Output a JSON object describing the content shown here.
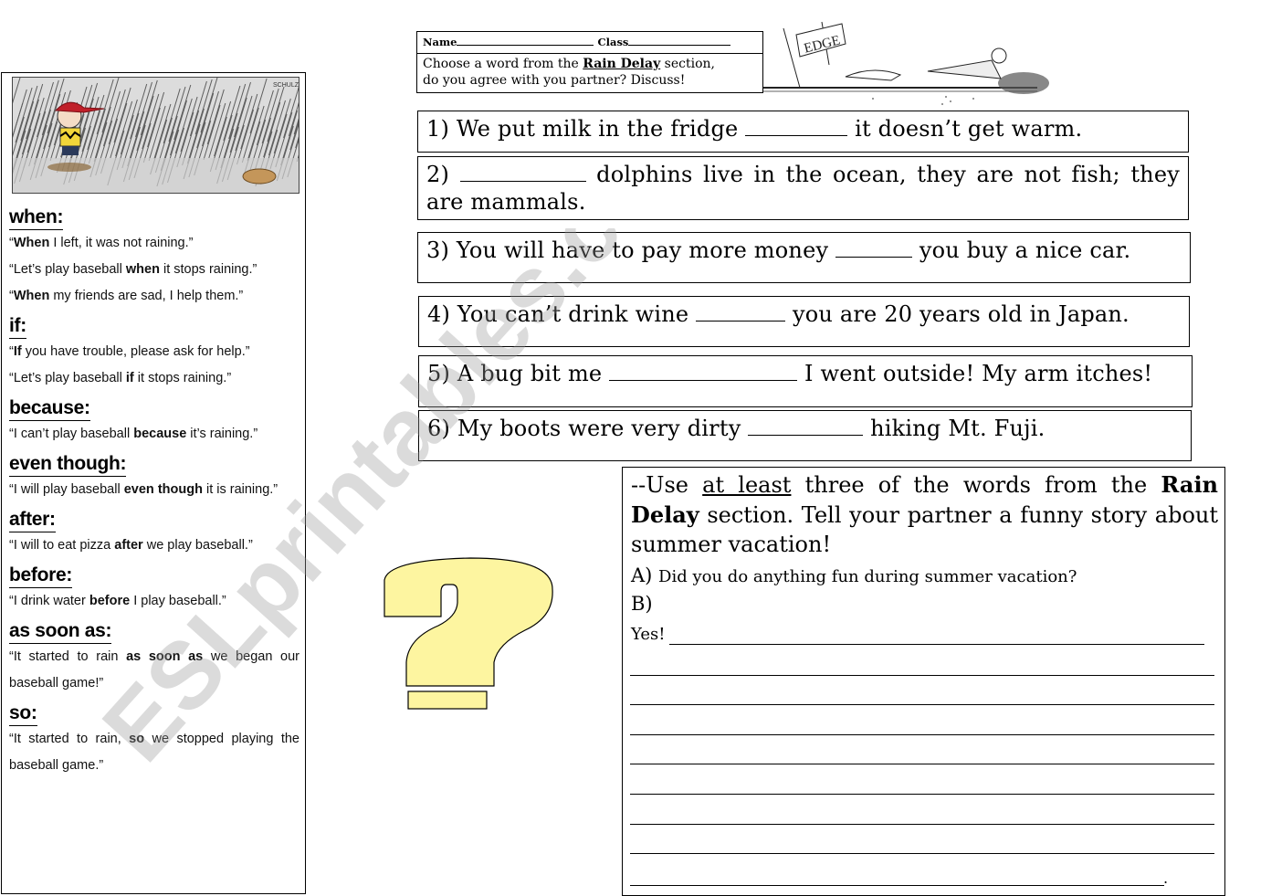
{
  "header": {
    "name_label": "Name",
    "class_label": "Class",
    "instruction_prefix": "Choose a word from the ",
    "instruction_bold": "Rain Delay",
    "instruction_suffix": " section,",
    "instruction_line2": "do you agree with you partner? Discuss!",
    "cartoon_sign": "EDGE"
  },
  "sidebar": {
    "comic_signature": "SCHULZ",
    "sections": [
      {
        "keyword": "when:",
        "examples": [
          {
            "pre": "“",
            "bold": "When",
            "post": " I left, it was not raining.”"
          },
          {
            "pre": "“Let’s play baseball ",
            "bold": "when",
            "post": " it stops raining.”"
          },
          {
            "pre": "“",
            "bold": "When",
            "post": " my friends are sad, I help them.”"
          }
        ]
      },
      {
        "keyword": "if:",
        "examples": [
          {
            "pre": "“",
            "bold": "If",
            "post": " you have trouble, please ask for help.”"
          },
          {
            "pre": "“Let’s play baseball ",
            "bold": "if",
            "post": " it stops raining.”"
          }
        ]
      },
      {
        "keyword": "because:",
        "examples": [
          {
            "pre": "“I can’t play baseball ",
            "bold": "because",
            "post": " it’s raining.”"
          }
        ]
      },
      {
        "keyword": "even though:",
        "examples": [
          {
            "pre": "“I will play baseball ",
            "bold": "even though",
            "post": " it is raining.”"
          }
        ]
      },
      {
        "keyword": "after:",
        "examples": [
          {
            "pre": "“I will to eat pizza ",
            "bold": "after",
            "post": " we play baseball.”"
          }
        ]
      },
      {
        "keyword": "before:",
        "examples": [
          {
            "pre": "“I drink water ",
            "bold": "before",
            "post": " I play baseball.”"
          }
        ]
      },
      {
        "keyword": "as soon as:",
        "examples": [
          {
            "pre": "“It started to rain ",
            "bold": "as soon as",
            "post": " we began our baseball game!”"
          }
        ]
      },
      {
        "keyword": "so:",
        "examples": [
          {
            "pre": "“It started to rain, ",
            "bold": "so",
            "post": " we stopped playing the baseball game.”"
          }
        ]
      }
    ]
  },
  "questions": [
    {
      "pre": "1) We put milk in the fridge ",
      "post": " it doesn’t get warm."
    },
    {
      "pre": "2) ",
      "post": " dolphins live in the ocean, they are not fish; they are mammals."
    },
    {
      "pre": "3) You will have to pay more money ",
      "post": " you buy a nice car."
    },
    {
      "pre": "4) You can’t drink wine ",
      "post": " you are 20 years old in Japan."
    },
    {
      "pre": "5) A bug bit me ",
      "post": " I went outside! My arm itches!"
    },
    {
      "pre": "6) My boots were very dirty ",
      "post": " hiking Mt. Fuji."
    }
  ],
  "story": {
    "prefix": "--Use ",
    "underlined": "at least",
    "middle": " three of the words from the ",
    "bold": "Rain Delay",
    "suffix": " section. Tell your partner a funny story about summer vacation!",
    "a_label": "A)",
    "a_question": "Did you do anything fun during summer vacation?",
    "b_label": "B)",
    "yes_label": "Yes!",
    "final_period": "."
  },
  "decor": {
    "question_mark_color": "#fdf5a0",
    "watermark": "ESLprintables.com"
  }
}
